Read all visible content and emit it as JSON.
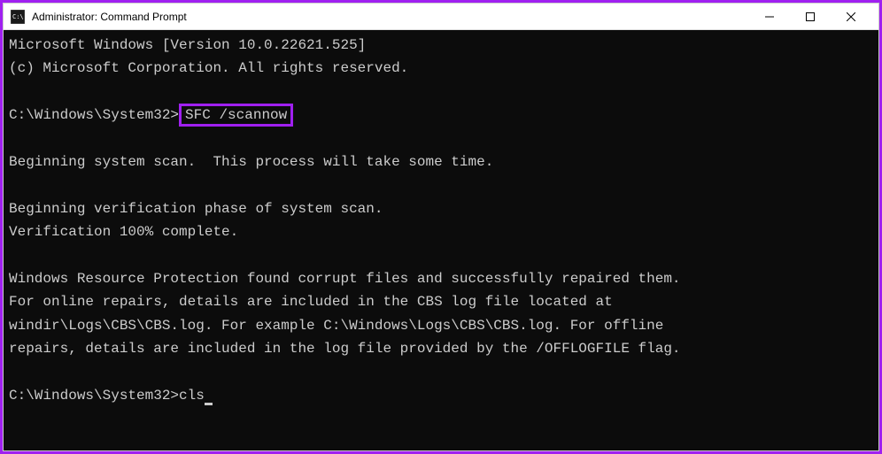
{
  "window": {
    "title": "Administrator: Command Prompt"
  },
  "terminal": {
    "line1": "Microsoft Windows [Version 10.0.22621.525]",
    "line2": "(c) Microsoft Corporation. All rights reserved.",
    "prompt1_path": "C:\\Windows\\System32>",
    "prompt1_command": "SFC /scannow",
    "scan_begin": "Beginning system scan.  This process will take some time.",
    "verify_begin": "Beginning verification phase of system scan.",
    "verify_complete": "Verification 100% complete.",
    "result1": "Windows Resource Protection found corrupt files and successfully repaired them.",
    "result2": "For online repairs, details are included in the CBS log file located at",
    "result3": "windir\\Logs\\CBS\\CBS.log. For example C:\\Windows\\Logs\\CBS\\CBS.log. For offline",
    "result4": "repairs, details are included in the log file provided by the /OFFLOGFILE flag.",
    "prompt2_path": "C:\\Windows\\System32>",
    "prompt2_command": "cls"
  }
}
